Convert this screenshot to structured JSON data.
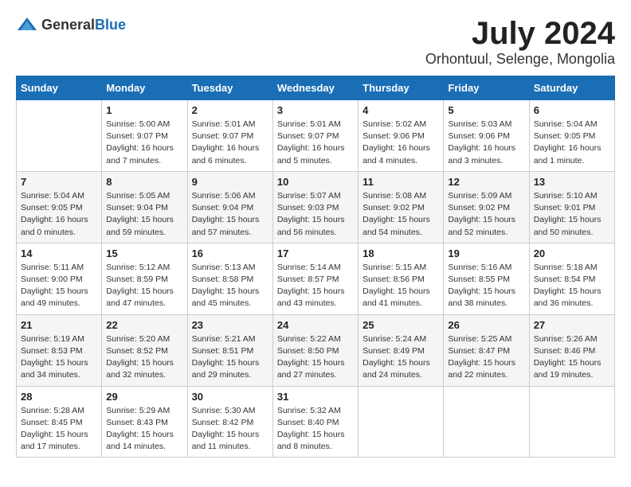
{
  "logo": {
    "general": "General",
    "blue": "Blue"
  },
  "title": "July 2024",
  "location": "Orhontuul, Selenge, Mongolia",
  "days_of_week": [
    "Sunday",
    "Monday",
    "Tuesday",
    "Wednesday",
    "Thursday",
    "Friday",
    "Saturday"
  ],
  "weeks": [
    [
      {
        "day": "",
        "info": ""
      },
      {
        "day": "1",
        "info": "Sunrise: 5:00 AM\nSunset: 9:07 PM\nDaylight: 16 hours\nand 7 minutes."
      },
      {
        "day": "2",
        "info": "Sunrise: 5:01 AM\nSunset: 9:07 PM\nDaylight: 16 hours\nand 6 minutes."
      },
      {
        "day": "3",
        "info": "Sunrise: 5:01 AM\nSunset: 9:07 PM\nDaylight: 16 hours\nand 5 minutes."
      },
      {
        "day": "4",
        "info": "Sunrise: 5:02 AM\nSunset: 9:06 PM\nDaylight: 16 hours\nand 4 minutes."
      },
      {
        "day": "5",
        "info": "Sunrise: 5:03 AM\nSunset: 9:06 PM\nDaylight: 16 hours\nand 3 minutes."
      },
      {
        "day": "6",
        "info": "Sunrise: 5:04 AM\nSunset: 9:05 PM\nDaylight: 16 hours\nand 1 minute."
      }
    ],
    [
      {
        "day": "7",
        "info": "Sunrise: 5:04 AM\nSunset: 9:05 PM\nDaylight: 16 hours\nand 0 minutes."
      },
      {
        "day": "8",
        "info": "Sunrise: 5:05 AM\nSunset: 9:04 PM\nDaylight: 15 hours\nand 59 minutes."
      },
      {
        "day": "9",
        "info": "Sunrise: 5:06 AM\nSunset: 9:04 PM\nDaylight: 15 hours\nand 57 minutes."
      },
      {
        "day": "10",
        "info": "Sunrise: 5:07 AM\nSunset: 9:03 PM\nDaylight: 15 hours\nand 56 minutes."
      },
      {
        "day": "11",
        "info": "Sunrise: 5:08 AM\nSunset: 9:02 PM\nDaylight: 15 hours\nand 54 minutes."
      },
      {
        "day": "12",
        "info": "Sunrise: 5:09 AM\nSunset: 9:02 PM\nDaylight: 15 hours\nand 52 minutes."
      },
      {
        "day": "13",
        "info": "Sunrise: 5:10 AM\nSunset: 9:01 PM\nDaylight: 15 hours\nand 50 minutes."
      }
    ],
    [
      {
        "day": "14",
        "info": "Sunrise: 5:11 AM\nSunset: 9:00 PM\nDaylight: 15 hours\nand 49 minutes."
      },
      {
        "day": "15",
        "info": "Sunrise: 5:12 AM\nSunset: 8:59 PM\nDaylight: 15 hours\nand 47 minutes."
      },
      {
        "day": "16",
        "info": "Sunrise: 5:13 AM\nSunset: 8:58 PM\nDaylight: 15 hours\nand 45 minutes."
      },
      {
        "day": "17",
        "info": "Sunrise: 5:14 AM\nSunset: 8:57 PM\nDaylight: 15 hours\nand 43 minutes."
      },
      {
        "day": "18",
        "info": "Sunrise: 5:15 AM\nSunset: 8:56 PM\nDaylight: 15 hours\nand 41 minutes."
      },
      {
        "day": "19",
        "info": "Sunrise: 5:16 AM\nSunset: 8:55 PM\nDaylight: 15 hours\nand 38 minutes."
      },
      {
        "day": "20",
        "info": "Sunrise: 5:18 AM\nSunset: 8:54 PM\nDaylight: 15 hours\nand 36 minutes."
      }
    ],
    [
      {
        "day": "21",
        "info": "Sunrise: 5:19 AM\nSunset: 8:53 PM\nDaylight: 15 hours\nand 34 minutes."
      },
      {
        "day": "22",
        "info": "Sunrise: 5:20 AM\nSunset: 8:52 PM\nDaylight: 15 hours\nand 32 minutes."
      },
      {
        "day": "23",
        "info": "Sunrise: 5:21 AM\nSunset: 8:51 PM\nDaylight: 15 hours\nand 29 minutes."
      },
      {
        "day": "24",
        "info": "Sunrise: 5:22 AM\nSunset: 8:50 PM\nDaylight: 15 hours\nand 27 minutes."
      },
      {
        "day": "25",
        "info": "Sunrise: 5:24 AM\nSunset: 8:49 PM\nDaylight: 15 hours\nand 24 minutes."
      },
      {
        "day": "26",
        "info": "Sunrise: 5:25 AM\nSunset: 8:47 PM\nDaylight: 15 hours\nand 22 minutes."
      },
      {
        "day": "27",
        "info": "Sunrise: 5:26 AM\nSunset: 8:46 PM\nDaylight: 15 hours\nand 19 minutes."
      }
    ],
    [
      {
        "day": "28",
        "info": "Sunrise: 5:28 AM\nSunset: 8:45 PM\nDaylight: 15 hours\nand 17 minutes."
      },
      {
        "day": "29",
        "info": "Sunrise: 5:29 AM\nSunset: 8:43 PM\nDaylight: 15 hours\nand 14 minutes."
      },
      {
        "day": "30",
        "info": "Sunrise: 5:30 AM\nSunset: 8:42 PM\nDaylight: 15 hours\nand 11 minutes."
      },
      {
        "day": "31",
        "info": "Sunrise: 5:32 AM\nSunset: 8:40 PM\nDaylight: 15 hours\nand 8 minutes."
      },
      {
        "day": "",
        "info": ""
      },
      {
        "day": "",
        "info": ""
      },
      {
        "day": "",
        "info": ""
      }
    ]
  ]
}
